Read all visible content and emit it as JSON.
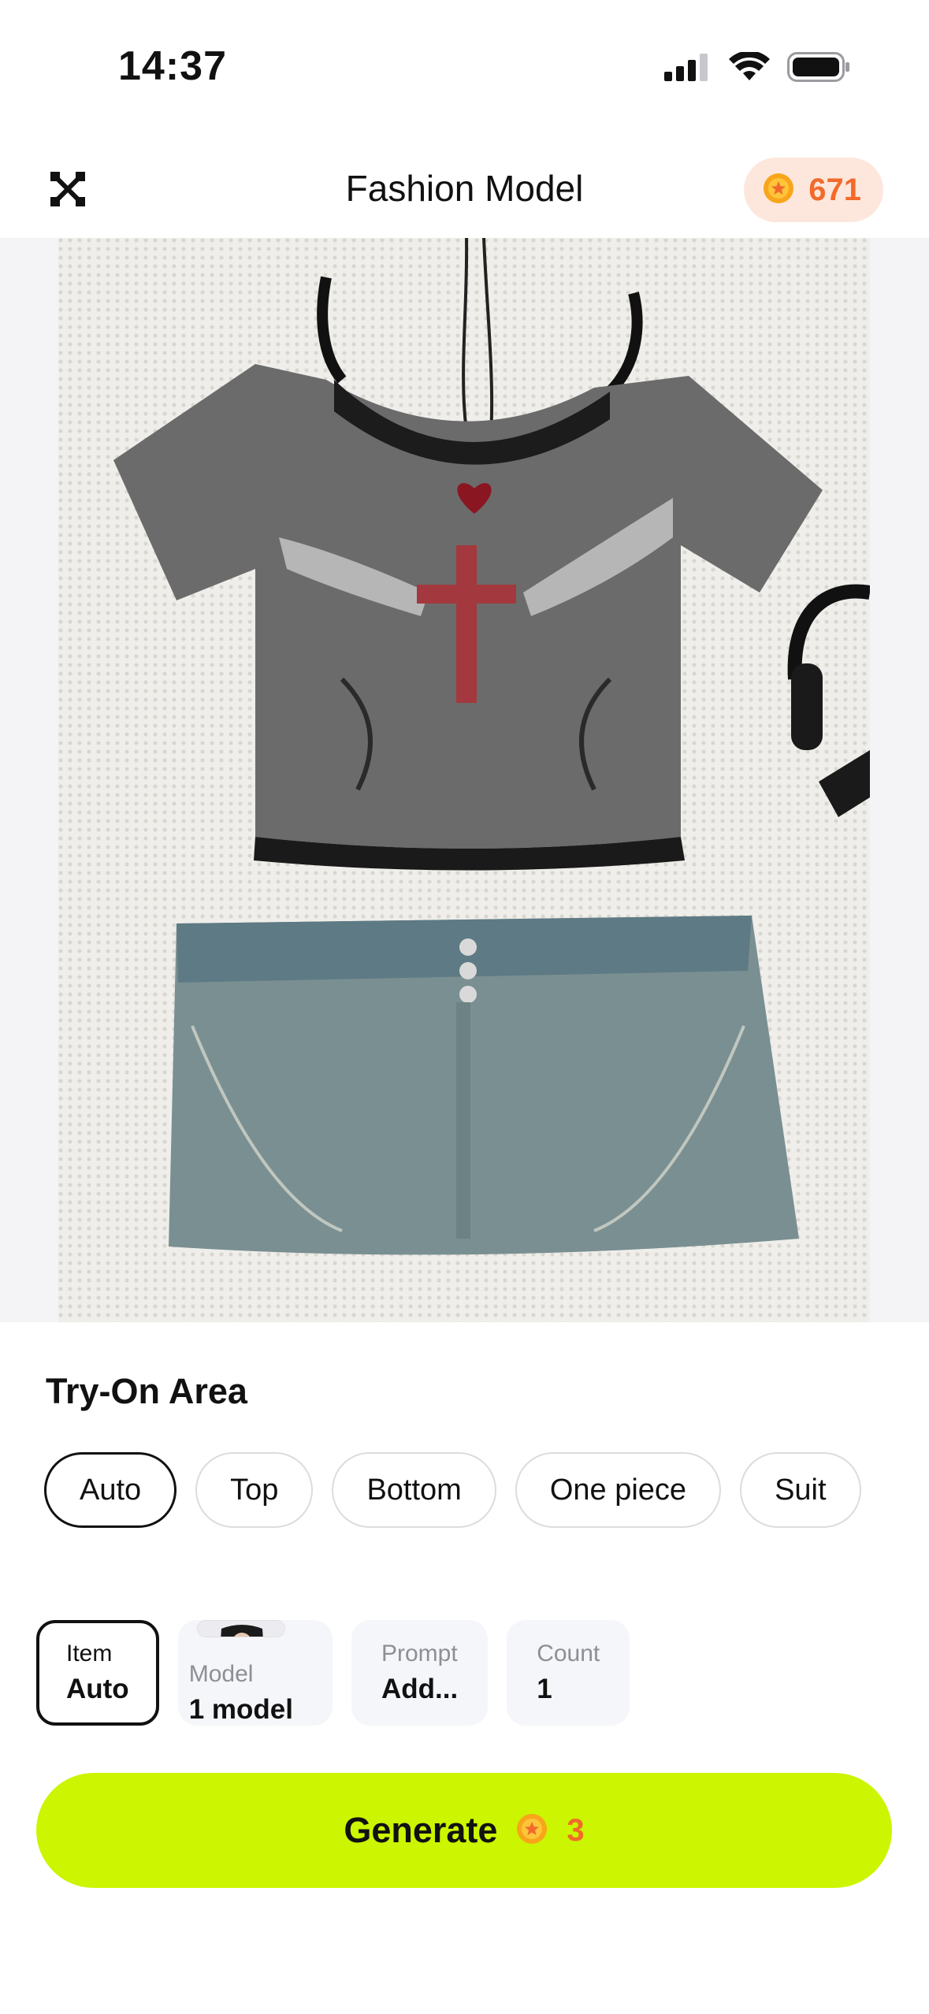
{
  "status_bar": {
    "time": "14:37"
  },
  "header": {
    "title": "Fashion Model",
    "coin_balance": "671"
  },
  "try_on": {
    "title": "Try-On Area",
    "options": [
      "Auto",
      "Top",
      "Bottom",
      "One piece",
      "Suit"
    ],
    "selected": "Auto"
  },
  "settings": {
    "item": {
      "label": "Item",
      "value": "Auto"
    },
    "model": {
      "label": "Model",
      "value": "1 model"
    },
    "prompt": {
      "label": "Prompt",
      "value": "Add..."
    },
    "count": {
      "label": "Count",
      "value": "1"
    }
  },
  "generate": {
    "label": "Generate",
    "cost": "3"
  },
  "colors": {
    "accent": "#cbf500",
    "coin": "#f26a2b",
    "coin_bg": "#fde7dc"
  }
}
